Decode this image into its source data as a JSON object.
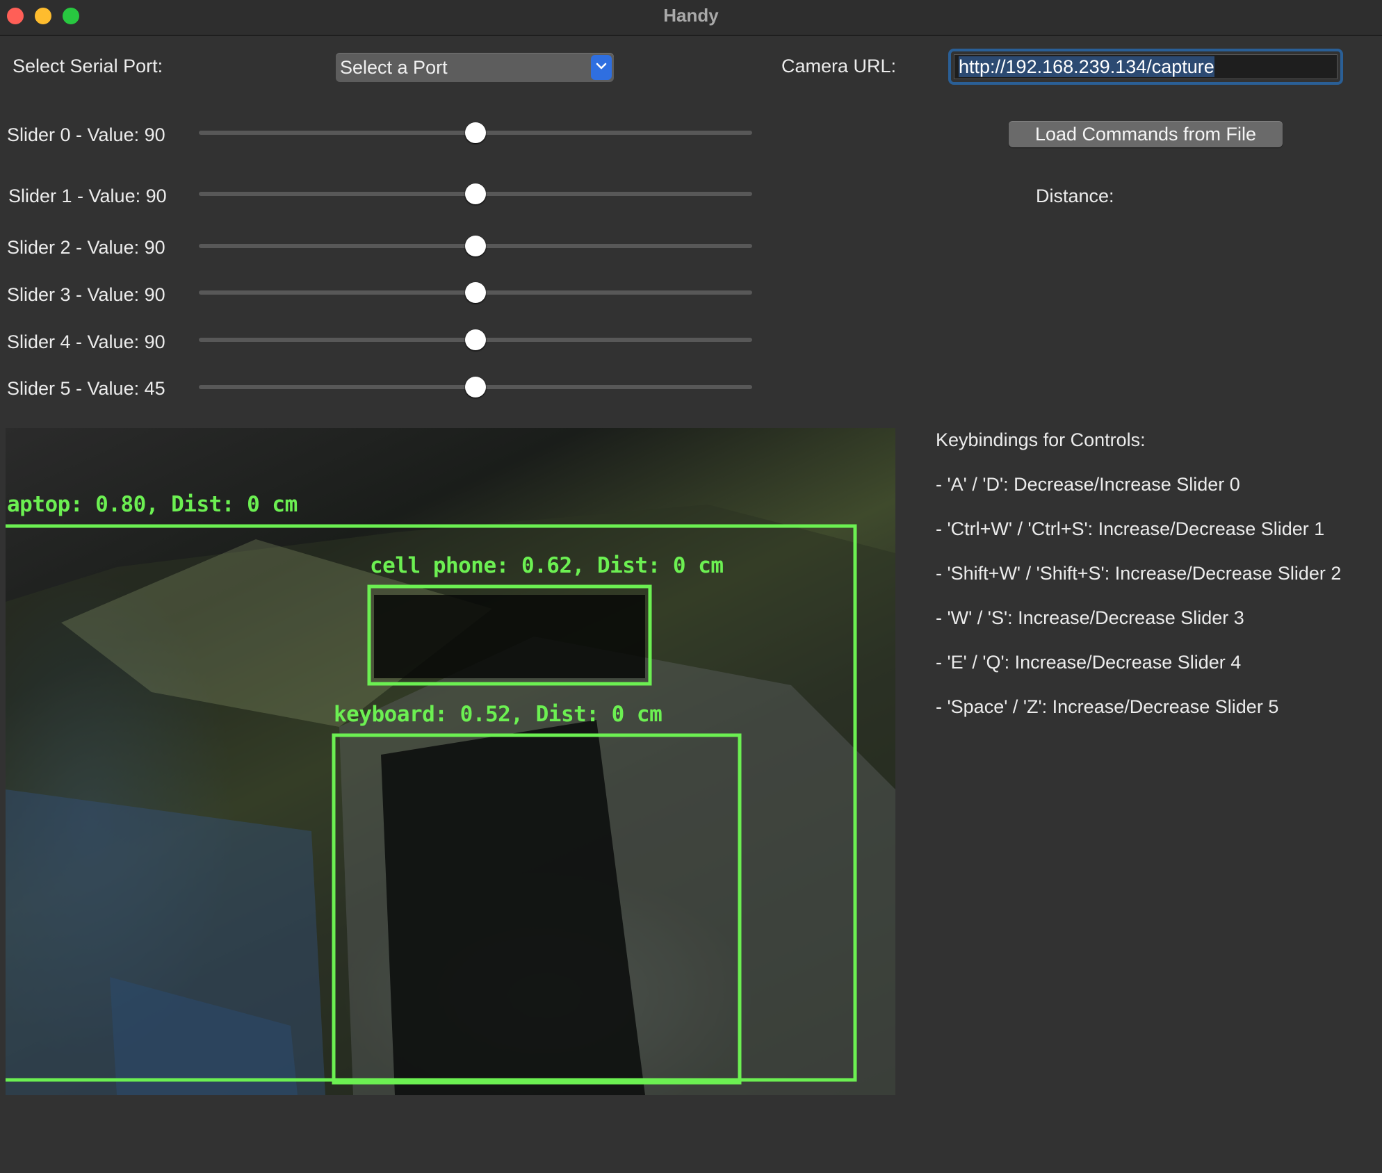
{
  "window": {
    "title": "Handy"
  },
  "serial": {
    "label": "Select Serial Port:",
    "selected": "Select a Port"
  },
  "camera": {
    "label": "Camera URL:",
    "url": "http://192.168.239.134/capture"
  },
  "buttons": {
    "load_commands": "Load Commands from File"
  },
  "distance": {
    "label": "Distance:"
  },
  "sliders": [
    {
      "label": "Slider 0 - Value: 90",
      "value": 0.5
    },
    {
      "label": "Slider 1 - Value: 90",
      "value": 0.5
    },
    {
      "label": "Slider 2 - Value: 90",
      "value": 0.5
    },
    {
      "label": "Slider 3 - Value: 90",
      "value": 0.5
    },
    {
      "label": "Slider 4 - Value: 90",
      "value": 0.5
    },
    {
      "label": "Slider 5 - Value: 45",
      "value": 0.5
    }
  ],
  "detections": [
    {
      "label": "aptop: 0.80, Dist: 0 cm",
      "color": "#6cf052"
    },
    {
      "label": "cell phone: 0.62, Dist: 0 cm",
      "color": "#6cf052"
    },
    {
      "label": "keyboard: 0.52, Dist: 0 cm",
      "color": "#6cf052"
    }
  ],
  "keybindings": {
    "title": "Keybindings for Controls:",
    "items": [
      "- 'A' / 'D': Decrease/Increase Slider 0",
      "- 'Ctrl+W' / 'Ctrl+S': Increase/Decrease Slider 1",
      "- 'Shift+W' / 'Shift+S': Increase/Decrease Slider 2",
      "- 'W' / 'S': Increase/Decrease Slider 3",
      "- 'E' / 'Q': Increase/Decrease Slider 4",
      "- 'Space' / 'Z': Increase/Decrease Slider 5"
    ]
  }
}
